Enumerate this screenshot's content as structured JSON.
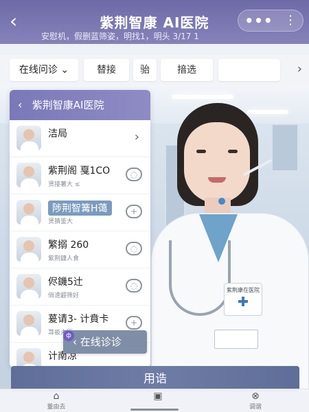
{
  "header": {
    "back_label": "‹",
    "title": "紫荆智康 AI医院",
    "more_label": "•••",
    "menu_label": "⋮",
    "subtitle": "安慰机，假删蓝筛姿，明找1，明头 3/17 1"
  },
  "tabs": {
    "items": [
      {
        "label": "在线问诊 ⌄"
      },
      {
        "label": "替接"
      },
      {
        "label": "骀"
      },
      {
        "label": "揞选"
      }
    ],
    "more_icon": "›"
  },
  "panel": {
    "title": "紫荆智康AI医院",
    "back_icon": "‹",
    "rows": [
      {
        "name": "洁局",
        "sub": "",
        "action": "›"
      },
      {
        "name": "紫荆阁 戛1CO",
        "sub": "贤接薯大 ≤",
        "action": "◌"
      },
      {
        "name": "陟荆智篝H蔼",
        "sub": "贤猜鉴大",
        "action": "+"
      },
      {
        "name": "繁搦 260",
        "sub": "紫荆鏮人食",
        "action": "◌"
      },
      {
        "name": "侭鐖5辻",
        "sub": "俏速鼹筛好",
        "action": "◌"
      },
      {
        "name": "萲请3- 计賁卡",
        "sub": "荨衱未嬴 ≥",
        "action": "+"
      },
      {
        "name": "计南凉",
        "sub": "",
        "action": ""
      }
    ]
  },
  "floating": {
    "dot": "ф",
    "label": "‹ 在线诊诊"
  },
  "cta": {
    "label": "用诰"
  },
  "tabbar": {
    "items": [
      {
        "icon": "⌂",
        "label": "董由去"
      },
      {
        "icon": "▣",
        "label": ""
      },
      {
        "icon": "⊗",
        "label": "调谐"
      }
    ]
  },
  "doctor_badge": "紫荆康在医院"
}
